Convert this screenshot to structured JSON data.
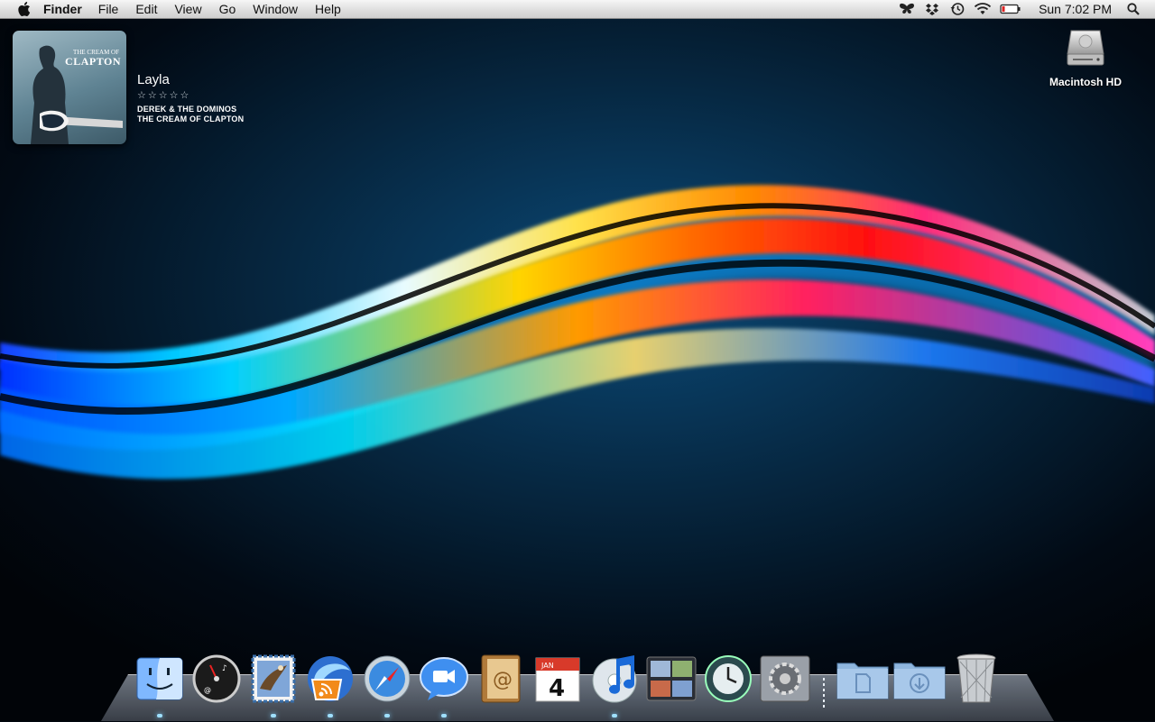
{
  "menubar": {
    "app_name": "Finder",
    "menus": [
      "File",
      "Edit",
      "View",
      "Go",
      "Window",
      "Help"
    ],
    "status_icons": [
      "butterfly-icon",
      "dropbox-icon",
      "time-machine-icon",
      "wifi-icon",
      "battery-icon"
    ],
    "clock": "Sun 7:02 PM"
  },
  "now_playing": {
    "album_art_text_small": "THE CREAM OF",
    "album_art_text_large": "CLAPTON",
    "title": "Layla",
    "rating_stars": "☆☆☆☆☆",
    "rating": 0,
    "artist": "DEREK & THE DOMINOS",
    "album": "THE CREAM OF CLAPTON"
  },
  "desktop": {
    "icons": [
      {
        "label": "Macintosh HD",
        "icon": "hard-drive-icon"
      }
    ]
  },
  "dock": {
    "apps": [
      {
        "name": "Finder",
        "icon": "finder-icon",
        "running": true
      },
      {
        "name": "Dashboard",
        "icon": "dashboard-icon",
        "running": false
      },
      {
        "name": "Mail",
        "icon": "mail-icon",
        "running": true
      },
      {
        "name": "RSS Reader",
        "icon": "rss-icon",
        "running": true
      },
      {
        "name": "Safari",
        "icon": "safari-icon",
        "running": true
      },
      {
        "name": "iChat",
        "icon": "ichat-icon",
        "running": true
      },
      {
        "name": "Address Book",
        "icon": "address-book-icon",
        "running": false
      },
      {
        "name": "iCal",
        "icon": "ical-icon",
        "running": false
      },
      {
        "name": "iTunes",
        "icon": "itunes-icon",
        "running": true
      },
      {
        "name": "Spaces",
        "icon": "spaces-icon",
        "running": false
      },
      {
        "name": "Time Machine",
        "icon": "time-machine-icon",
        "running": false
      },
      {
        "name": "System Preferences",
        "icon": "system-preferences-icon",
        "running": false
      }
    ],
    "calendar_month": "JAN",
    "calendar_day": "4",
    "folders": [
      {
        "name": "Documents",
        "icon": "documents-folder-icon"
      },
      {
        "name": "Downloads",
        "icon": "downloads-folder-icon"
      }
    ],
    "trash": {
      "name": "Trash",
      "icon": "trash-icon"
    }
  }
}
